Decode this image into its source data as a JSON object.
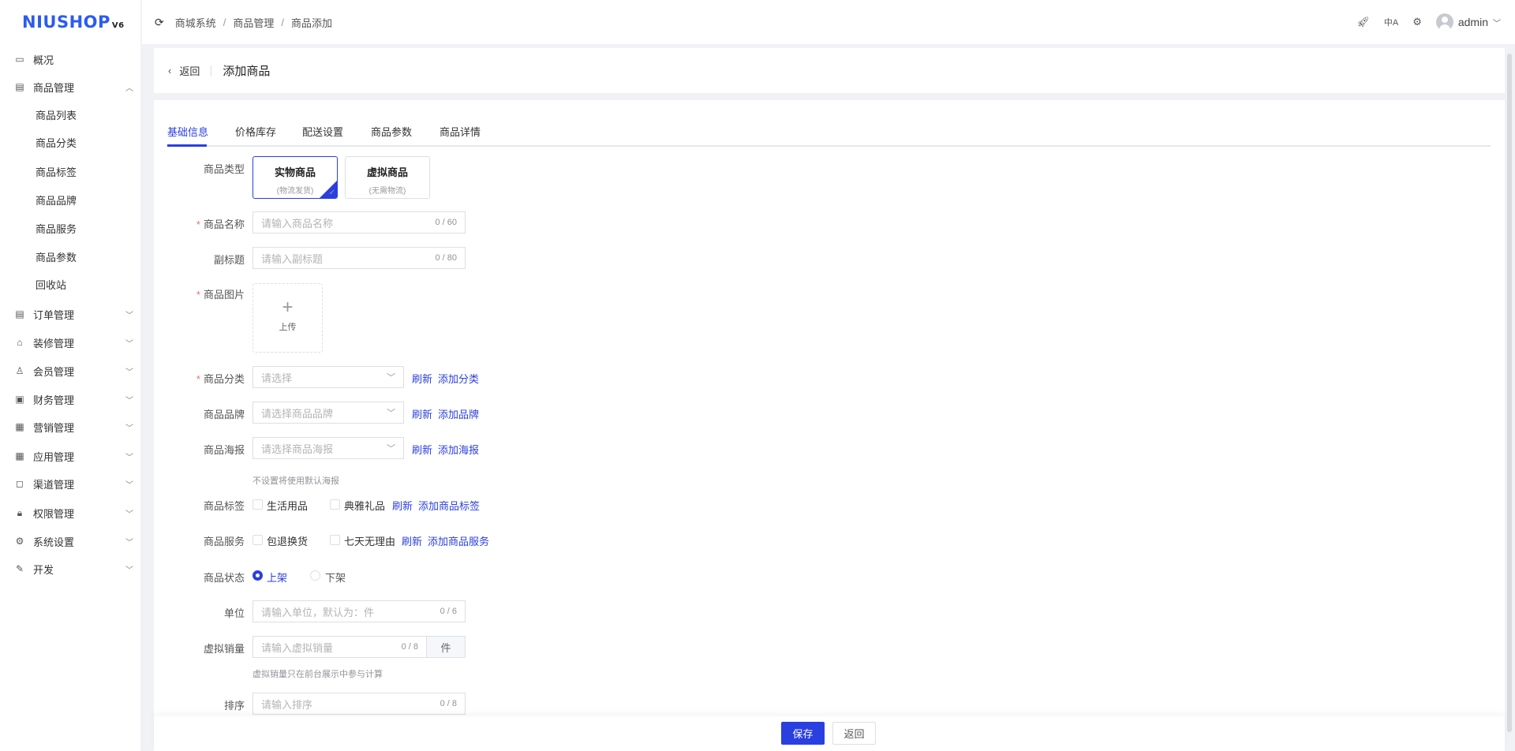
{
  "logo": {
    "text": "NIUSHOP",
    "version": "V6"
  },
  "sidebar": {
    "items": [
      {
        "label": "概况",
        "icon": "chart-icon"
      },
      {
        "label": "商品管理",
        "icon": "goods-icon",
        "expanded": true,
        "children": [
          "商品列表",
          "商品分类",
          "商品标签",
          "商品品牌",
          "商品服务",
          "商品参数",
          "回收站"
        ]
      },
      {
        "label": "订单管理",
        "icon": "order-icon"
      },
      {
        "label": "装修管理",
        "icon": "decorate-icon"
      },
      {
        "label": "会员管理",
        "icon": "member-icon"
      },
      {
        "label": "财务管理",
        "icon": "finance-icon"
      },
      {
        "label": "营销管理",
        "icon": "gift-icon"
      },
      {
        "label": "应用管理",
        "icon": "apps-icon"
      },
      {
        "label": "渠道管理",
        "icon": "channel-icon"
      },
      {
        "label": "权限管理",
        "icon": "lock-icon"
      },
      {
        "label": "系统设置",
        "icon": "gear-icon"
      },
      {
        "label": "开发",
        "icon": "edit-icon"
      }
    ]
  },
  "header": {
    "breadcrumb": [
      "商城系统",
      "商品管理",
      "商品添加"
    ],
    "user": "admin"
  },
  "page": {
    "back": "返回",
    "title": "添加商品"
  },
  "tabs": [
    "基础信息",
    "价格库存",
    "配送设置",
    "商品参数",
    "商品详情"
  ],
  "form": {
    "type": {
      "label": "商品类型",
      "options": [
        {
          "title": "实物商品",
          "sub": "(物流发货)",
          "selected": true
        },
        {
          "title": "虚拟商品",
          "sub": "(无需物流)",
          "selected": false
        }
      ]
    },
    "name": {
      "label": "商品名称",
      "placeholder": "请输入商品名称",
      "count": "0 / 60"
    },
    "subtitle": {
      "label": "副标题",
      "placeholder": "请输入副标题",
      "count": "0 / 80"
    },
    "image": {
      "label": "商品图片",
      "upload": "上传"
    },
    "category": {
      "label": "商品分类",
      "placeholder": "请选择",
      "refresh": "刷新",
      "add": "添加分类"
    },
    "brand": {
      "label": "商品品牌",
      "placeholder": "请选择商品品牌",
      "refresh": "刷新",
      "add": "添加品牌"
    },
    "poster": {
      "label": "商品海报",
      "placeholder": "请选择商品海报",
      "refresh": "刷新",
      "add": "添加海报",
      "hint": "不设置将使用默认海报"
    },
    "tags": {
      "label": "商品标签",
      "options": [
        "生活用品",
        "典雅礼品"
      ],
      "refresh": "刷新",
      "add": "添加商品标签"
    },
    "services": {
      "label": "商品服务",
      "options": [
        "包退换货",
        "七天无理由"
      ],
      "refresh": "刷新",
      "add": "添加商品服务"
    },
    "status": {
      "label": "商品状态",
      "options": [
        "上架",
        "下架"
      ],
      "selected": "上架"
    },
    "unit": {
      "label": "单位",
      "placeholder": "请输入单位，默认为：件",
      "count": "0 / 6"
    },
    "virtual_sales": {
      "label": "虚拟销量",
      "placeholder": "请输入虚拟销量",
      "count": "0 / 8",
      "suffix": "件",
      "hint": "虚拟销量只在前台展示中参与计算"
    },
    "sort": {
      "label": "排序",
      "placeholder": "请输入排序",
      "count": "0 / 8"
    }
  },
  "footer": {
    "save": "保存",
    "back": "返回"
  },
  "colors": {
    "primary": "#2a3fe0",
    "required": "#f56c6c"
  }
}
